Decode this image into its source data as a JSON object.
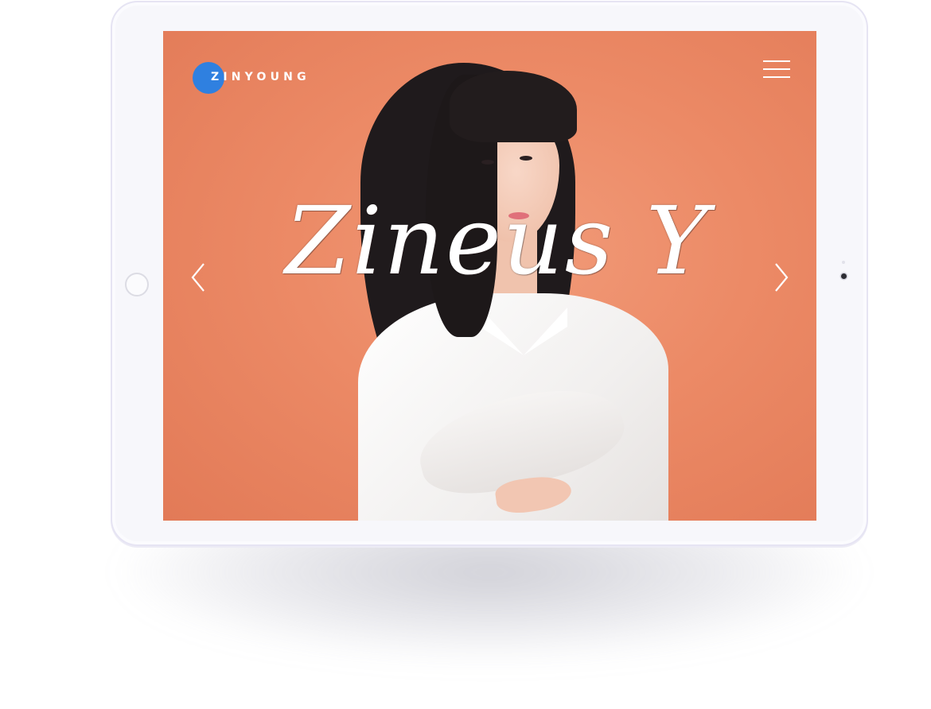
{
  "brand": {
    "name": "ZINYOUNG",
    "accent_color": "#2f80e0"
  },
  "hero": {
    "title": "Zineus Y",
    "background_color": "#ec8a66"
  },
  "navigation": {
    "menu_icon": "hamburger-icon",
    "prev_icon": "chevron-left-icon",
    "next_icon": "chevron-right-icon"
  },
  "device": {
    "type": "tablet",
    "frame_color": "#f7f7fb"
  }
}
